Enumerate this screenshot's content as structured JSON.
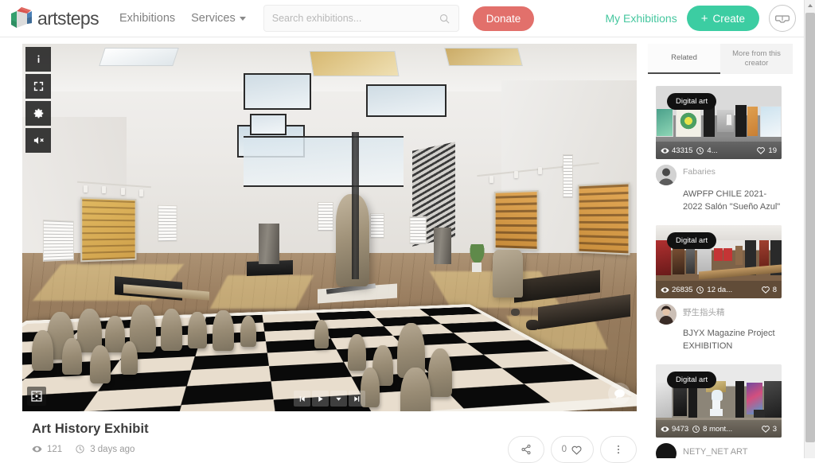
{
  "header": {
    "brand": "artsteps",
    "nav": [
      {
        "label": "Exhibitions",
        "has_caret": false
      },
      {
        "label": "Services",
        "has_caret": true
      }
    ],
    "search": {
      "placeholder": "Search exhibitions...",
      "value": "",
      "icon": "search-icon"
    },
    "donate_label": "Donate",
    "my_exhibitions_label": "My Exhibitions",
    "create_label": "Create",
    "create_icon": "plus-icon",
    "vr_icon": "vr-headset-icon",
    "colors": {
      "teal": "#3ccda2",
      "donate_red": "#e2706b",
      "nav_gray": "#808080"
    }
  },
  "viewer": {
    "toolbar": [
      {
        "name": "info-button",
        "icon": "info-icon"
      },
      {
        "name": "fullscreen-button",
        "icon": "fullscreen-icon"
      },
      {
        "name": "settings-button",
        "icon": "gear-icon"
      },
      {
        "name": "mute-button",
        "icon": "speaker-muted-icon"
      }
    ],
    "bottom_left_icon": "floorplan-map-icon",
    "bottom_right_icon": "chat-bubble-icon",
    "playback": [
      {
        "name": "previous-button",
        "icon": "skip-back-icon"
      },
      {
        "name": "play-button",
        "icon": "play-icon"
      },
      {
        "name": "tour-dropdown-button",
        "icon": "chevron-down-icon"
      },
      {
        "name": "next-button",
        "icon": "skip-forward-icon"
      }
    ]
  },
  "exhibition": {
    "title": "Art History Exhibit",
    "views": "121",
    "views_icon": "eye-icon",
    "time_icon": "clock-icon",
    "time_ago": "3 days ago",
    "actions": {
      "share_icon": "share-icon",
      "like_count": "0",
      "like_icon": "heart-icon",
      "more_icon": "more-vertical-icon"
    }
  },
  "sidebar": {
    "tabs": [
      {
        "label": "Related",
        "active": true
      },
      {
        "label": "More from this creator",
        "active": false
      }
    ],
    "cards": [
      {
        "badge": "Digital art",
        "views": "43315",
        "time": "4...",
        "likes": "19",
        "author": "Fabaries",
        "title": "AWPFP CHILE 2021-2022 Salón \"Sueño Azul\""
      },
      {
        "badge": "Digital art",
        "views": "26835",
        "time": "12 da...",
        "likes": "8",
        "author": "野生指头精",
        "title": "BJYX Magazine Project EXHIBITION"
      },
      {
        "badge": "Digital art",
        "views": "9473",
        "time": "8 mont...",
        "likes": "3",
        "author": "",
        "title": "NETY_NET ART"
      }
    ]
  },
  "scrollbar": {
    "position": "right",
    "arrow_icon": "scroll-up-icon"
  }
}
